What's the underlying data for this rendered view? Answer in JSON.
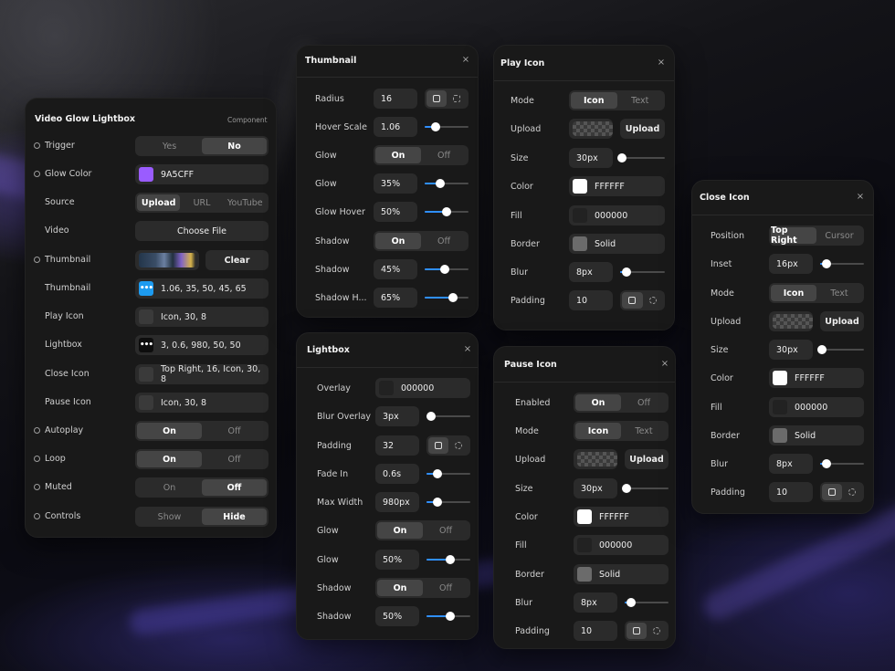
{
  "main": {
    "title": "Video Glow Lightbox",
    "subtitle": "Component",
    "rows": {
      "trigger": {
        "label": "Trigger",
        "options": [
          "Yes",
          "No"
        ]
      },
      "glow_color": {
        "label": "Glow Color",
        "value": "9A5CFF",
        "color": "#9A5CFF"
      },
      "source": {
        "label": "Source",
        "options": [
          "Upload",
          "URL",
          "YouTube"
        ]
      },
      "video": {
        "label": "Video",
        "button": "Choose File"
      },
      "thumbnail_upload": {
        "label": "Thumbnail",
        "button": "Clear"
      },
      "thumbnail": {
        "label": "Thumbnail",
        "value": "1.06, 35, 50, 45, 65",
        "color": "#1D9BF0"
      },
      "play_icon": {
        "label": "Play Icon",
        "value": "Icon, 30, 8"
      },
      "lightbox": {
        "label": "Lightbox",
        "value": "3, 0.6, 980, 50, 50"
      },
      "close_icon": {
        "label": "Close Icon",
        "value": "Top Right, 16, Icon, 30, 8"
      },
      "pause_icon": {
        "label": "Pause Icon",
        "value": "Icon, 30, 8"
      },
      "autoplay": {
        "label": "Autoplay",
        "options": [
          "On",
          "Off"
        ]
      },
      "loop": {
        "label": "Loop",
        "options": [
          "On",
          "Off"
        ]
      },
      "muted": {
        "label": "Muted",
        "options": [
          "On",
          "Off"
        ]
      },
      "controls": {
        "label": "Controls",
        "options": [
          "Show",
          "Hide"
        ]
      }
    }
  },
  "thumbnail_panel": {
    "title": "Thumbnail",
    "close": "×",
    "radius": {
      "label": "Radius",
      "value": "16"
    },
    "hover_scale": {
      "label": "Hover Scale",
      "value": "1.06",
      "level": 0.25
    },
    "glow_toggle": {
      "label": "Glow",
      "options": [
        "On",
        "Off"
      ]
    },
    "glow": {
      "label": "Glow",
      "value": "35%",
      "level": 0.35
    },
    "glow_hover": {
      "label": "Glow Hover",
      "value": "50%",
      "level": 0.5
    },
    "shadow_toggle": {
      "label": "Shadow",
      "options": [
        "On",
        "Off"
      ]
    },
    "shadow": {
      "label": "Shadow",
      "value": "45%",
      "level": 0.45
    },
    "shadow_hover": {
      "label": "Shadow H...",
      "value": "65%",
      "level": 0.65
    }
  },
  "play_panel": {
    "title": "Play Icon",
    "close": "×",
    "mode": {
      "label": "Mode",
      "options": [
        "Icon",
        "Text"
      ]
    },
    "upload": {
      "label": "Upload",
      "button": "Upload"
    },
    "size": {
      "label": "Size",
      "value": "30px",
      "level": 0.05
    },
    "color": {
      "label": "Color",
      "value": "FFFFFF",
      "color": "#FFFFFF"
    },
    "fill": {
      "label": "Fill",
      "value": "000000",
      "color": "#000000"
    },
    "border": {
      "label": "Border",
      "value": "Solid",
      "color": "#6b6b6b"
    },
    "blur": {
      "label": "Blur",
      "value": "8px",
      "level": 0.15
    },
    "padding": {
      "label": "Padding",
      "value": "10"
    }
  },
  "lightbox_panel": {
    "title": "Lightbox",
    "close": "×",
    "overlay": {
      "label": "Overlay",
      "value": "000000",
      "color": "#000000"
    },
    "blur_overlay": {
      "label": "Blur Overlay",
      "value": "3px",
      "level": 0.1
    },
    "padding": {
      "label": "Padding",
      "value": "32"
    },
    "fade_in": {
      "label": "Fade In",
      "value": "0.6s",
      "level": 0.25
    },
    "max_width": {
      "label": "Max Width",
      "value": "980px",
      "level": 0.25
    },
    "glow_toggle": {
      "label": "Glow",
      "options": [
        "On",
        "Off"
      ]
    },
    "glow": {
      "label": "Glow",
      "value": "50%",
      "level": 0.55
    },
    "shadow_toggle": {
      "label": "Shadow",
      "options": [
        "On",
        "Off"
      ]
    },
    "shadow": {
      "label": "Shadow",
      "value": "50%",
      "level": 0.55
    }
  },
  "pause_panel": {
    "title": "Pause Icon",
    "close": "×",
    "enabled": {
      "label": "Enabled",
      "options": [
        "On",
        "Off"
      ]
    },
    "mode": {
      "label": "Mode",
      "options": [
        "Icon",
        "Text"
      ]
    },
    "upload": {
      "label": "Upload",
      "button": "Upload"
    },
    "size": {
      "label": "Size",
      "value": "30px",
      "level": 0.05
    },
    "color": {
      "label": "Color",
      "value": "FFFFFF",
      "color": "#FFFFFF"
    },
    "fill": {
      "label": "Fill",
      "value": "000000",
      "color": "#000000"
    },
    "border": {
      "label": "Border",
      "value": "Solid",
      "color": "#6b6b6b"
    },
    "blur": {
      "label": "Blur",
      "value": "8px",
      "level": 0.15
    },
    "padding": {
      "label": "Padding",
      "value": "10"
    }
  },
  "close_panel": {
    "title": "Close Icon",
    "close": "×",
    "position": {
      "label": "Position",
      "options": [
        "Top Right",
        "Cursor"
      ]
    },
    "inset": {
      "label": "Inset",
      "value": "16px",
      "level": 0.15
    },
    "mode": {
      "label": "Mode",
      "options": [
        "Icon",
        "Text"
      ]
    },
    "upload": {
      "label": "Upload",
      "button": "Upload"
    },
    "size": {
      "label": "Size",
      "value": "30px",
      "level": 0.05
    },
    "color": {
      "label": "Color",
      "value": "FFFFFF",
      "color": "#FFFFFF"
    },
    "fill": {
      "label": "Fill",
      "value": "000000",
      "color": "#000000"
    },
    "border": {
      "label": "Border",
      "value": "Solid",
      "color": "#6b6b6b"
    },
    "blur": {
      "label": "Blur",
      "value": "8px",
      "level": 0.15
    },
    "padding": {
      "label": "Padding",
      "value": "10"
    }
  },
  "theme": {
    "accent": "#2F8FFF",
    "panel": "#191919",
    "control": "#2B2B2B",
    "selected": "#454545"
  }
}
